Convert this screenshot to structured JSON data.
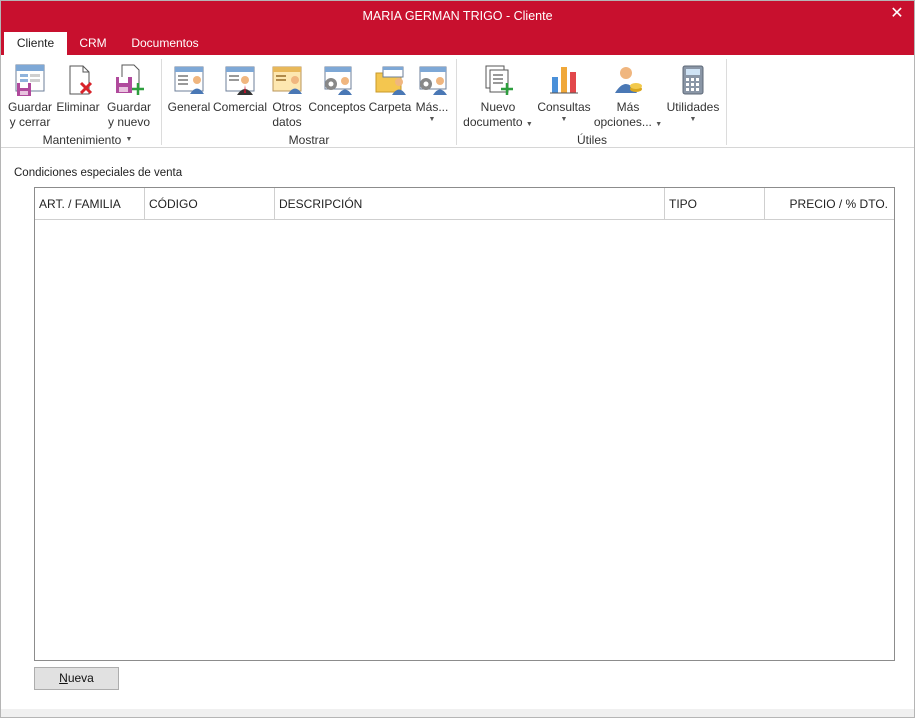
{
  "window": {
    "title": "MARIA GERMAN TRIGO - Cliente",
    "close": "✕"
  },
  "tabs": [
    {
      "label": "Cliente",
      "active": true
    },
    {
      "label": "CRM",
      "active": false
    },
    {
      "label": "Documentos",
      "active": false
    }
  ],
  "ribbon": {
    "groups": {
      "mantenimiento": "Mantenimiento",
      "mostrar": "Mostrar",
      "utiles": "Útiles"
    },
    "buttons": {
      "guardar_cerrar": [
        "Guardar",
        "y cerrar"
      ],
      "eliminar": "Eliminar",
      "guardar_nuevo": [
        "Guardar",
        "y nuevo"
      ],
      "general": "General",
      "comercial": "Comercial",
      "otros_datos": [
        "Otros",
        "datos"
      ],
      "conceptos": "Conceptos",
      "carpeta": "Carpeta",
      "mas": "Más...",
      "nuevo_documento": [
        "Nuevo",
        "documento"
      ],
      "consultas": "Consultas",
      "mas_opciones": [
        "Más",
        "opciones..."
      ],
      "utilidades": "Utilidades"
    },
    "caret": "▼"
  },
  "content": {
    "section_label": "Condiciones especiales de venta",
    "columns": [
      "ART. / FAMILIA",
      "CÓDIGO",
      "DESCRIPCIÓN",
      "TIPO",
      "PRECIO / % DTO."
    ],
    "rows": [],
    "nueva_button": {
      "underlined": "N",
      "rest": "ueva"
    }
  },
  "colors": {
    "accent": "#c8102e"
  }
}
